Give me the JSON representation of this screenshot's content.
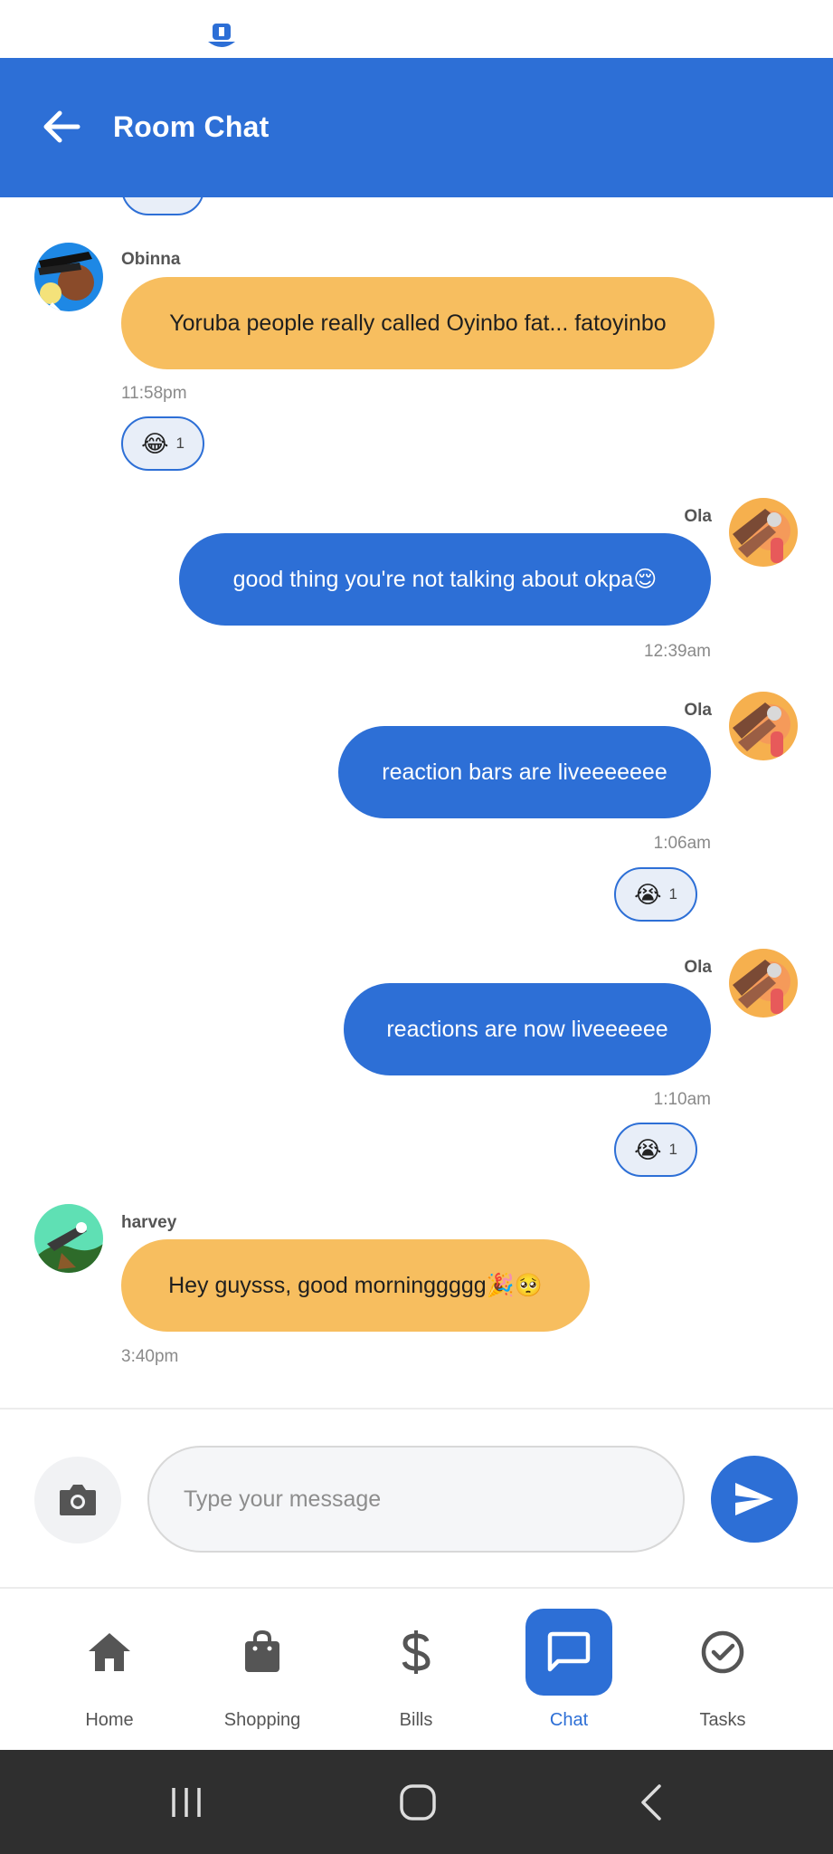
{
  "header": {
    "title": "Room Chat"
  },
  "messages": [
    {
      "sender": "Obinna",
      "text": "Yoruba people really called Oyinbo fat... fatoyinbo",
      "time": "11:58pm",
      "reaction": {
        "emoji": "😂",
        "count": "1"
      }
    },
    {
      "sender": "Ola",
      "text": "good thing you're not talking about okpa😌",
      "time": "12:39am"
    },
    {
      "sender": "Ola",
      "text": "reaction bars are liveeeeeee",
      "time": "1:06am",
      "reaction": {
        "emoji": "😭",
        "count": "1"
      }
    },
    {
      "sender": "Ola",
      "text": "reactions are now liveeeeee",
      "time": "1:10am",
      "reaction": {
        "emoji": "😭",
        "count": "1"
      }
    },
    {
      "sender": "harvey",
      "text": "Hey guysss, good morninggggg🎉🥺",
      "time": "3:40pm"
    }
  ],
  "composer": {
    "placeholder": "Type your message"
  },
  "nav": {
    "items": [
      {
        "label": "Home",
        "icon": "home-icon"
      },
      {
        "label": "Shopping",
        "icon": "shopping-bag-icon"
      },
      {
        "label": "Bills",
        "icon": "dollar-icon"
      },
      {
        "label": "Chat",
        "icon": "chat-icon",
        "active": true
      },
      {
        "label": "Tasks",
        "icon": "check-circle-icon"
      }
    ]
  },
  "colors": {
    "primary": "#2d6fd6",
    "incoming_bubble": "#f7be5f",
    "system_bar": "#2f2f2f"
  }
}
